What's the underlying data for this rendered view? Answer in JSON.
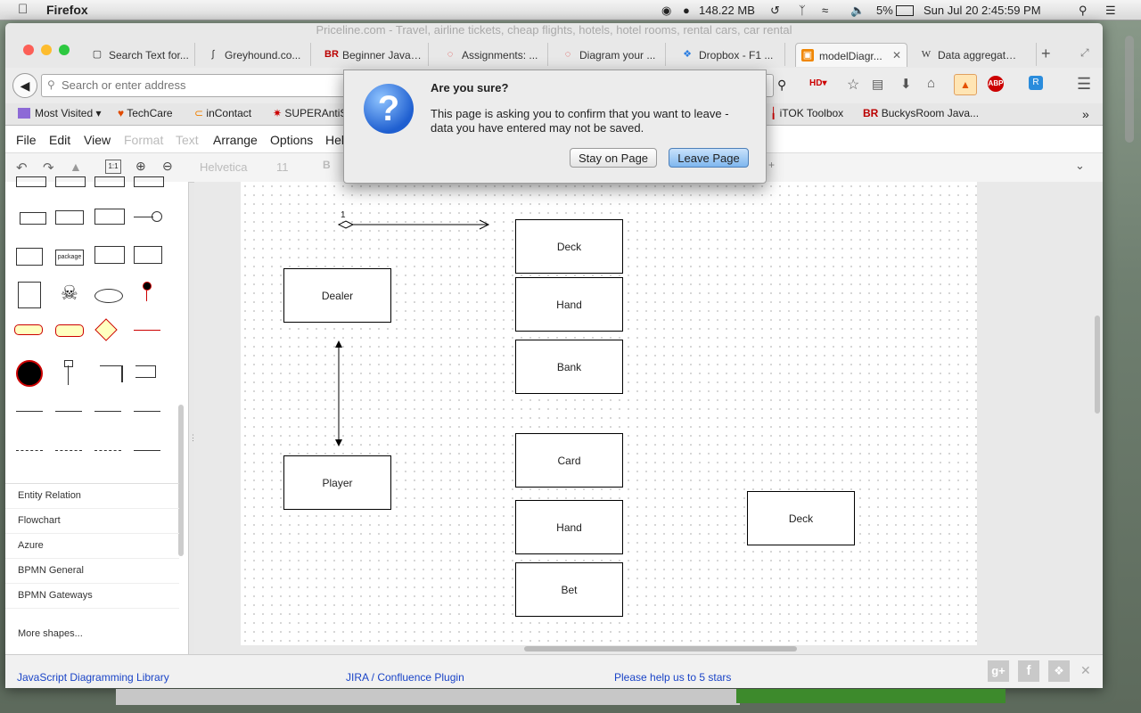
{
  "menubar": {
    "app": "Firefox",
    "memory": "148.22 MB",
    "battery": "5%",
    "datetime": "Sun Jul 20  2:45:59 PM"
  },
  "window": {
    "title": "Priceline.com - Travel, airline tickets, cheap flights, hotels, hotel rooms, rental cars, car rental"
  },
  "tabs": [
    {
      "label": "Search Text for...",
      "icon": "page-icon"
    },
    {
      "label": "Greyhound.co...",
      "icon": "greyhound-icon"
    },
    {
      "label": "Beginner JavaS...",
      "icon": "br-icon"
    },
    {
      "label": "Assignments: ...",
      "icon": "loading-icon"
    },
    {
      "label": "Diagram your ...",
      "icon": "loading-icon"
    },
    {
      "label": "Dropbox - F1 ...",
      "icon": "dropbox-icon"
    },
    {
      "label": "modelDiagr...",
      "icon": "drawio-icon",
      "active": true
    },
    {
      "label": "Data aggregato...",
      "icon": "wikipedia-icon"
    }
  ],
  "nav": {
    "url_placeholder": "Search or enter address"
  },
  "bookmarks": [
    {
      "label": "Most Visited"
    },
    {
      "label": "TechCare"
    },
    {
      "label": "inContact"
    },
    {
      "label": "SUPERAntiS"
    },
    {
      "label": "iTOK Toolbox"
    },
    {
      "label": "BuckysRoom Java..."
    }
  ],
  "appmenu": [
    "File",
    "Edit",
    "View",
    "Format",
    "Text",
    "Arrange",
    "Options",
    "Hel"
  ],
  "toolbar": {
    "font": "Helvetica",
    "size": "11",
    "bold": "B"
  },
  "sidebar": {
    "shape_labels": {
      "package": "package"
    },
    "categories": [
      "Entity Relation",
      "Flowchart",
      "Azure",
      "BPMN General",
      "BPMN Gateways"
    ],
    "more": "More shapes..."
  },
  "diagram": {
    "multiplicity": "1",
    "boxes": {
      "deck1": "Deck",
      "hand1": "Hand",
      "bank": "Bank",
      "dealer": "Dealer",
      "player": "Player",
      "card": "Card",
      "hand2": "Hand",
      "bet": "Bet",
      "deck2": "Deck"
    }
  },
  "footer": {
    "link1": "JavaScript Diagramming Library",
    "link2": "JIRA / Confluence Plugin",
    "link3": "Please help us to 5 stars"
  },
  "dialog": {
    "title": "Are you sure?",
    "message": "This page is asking you to confirm that you want to leave - data you have entered may not be saved.",
    "stay": "Stay on Page",
    "leave": "Leave Page"
  }
}
